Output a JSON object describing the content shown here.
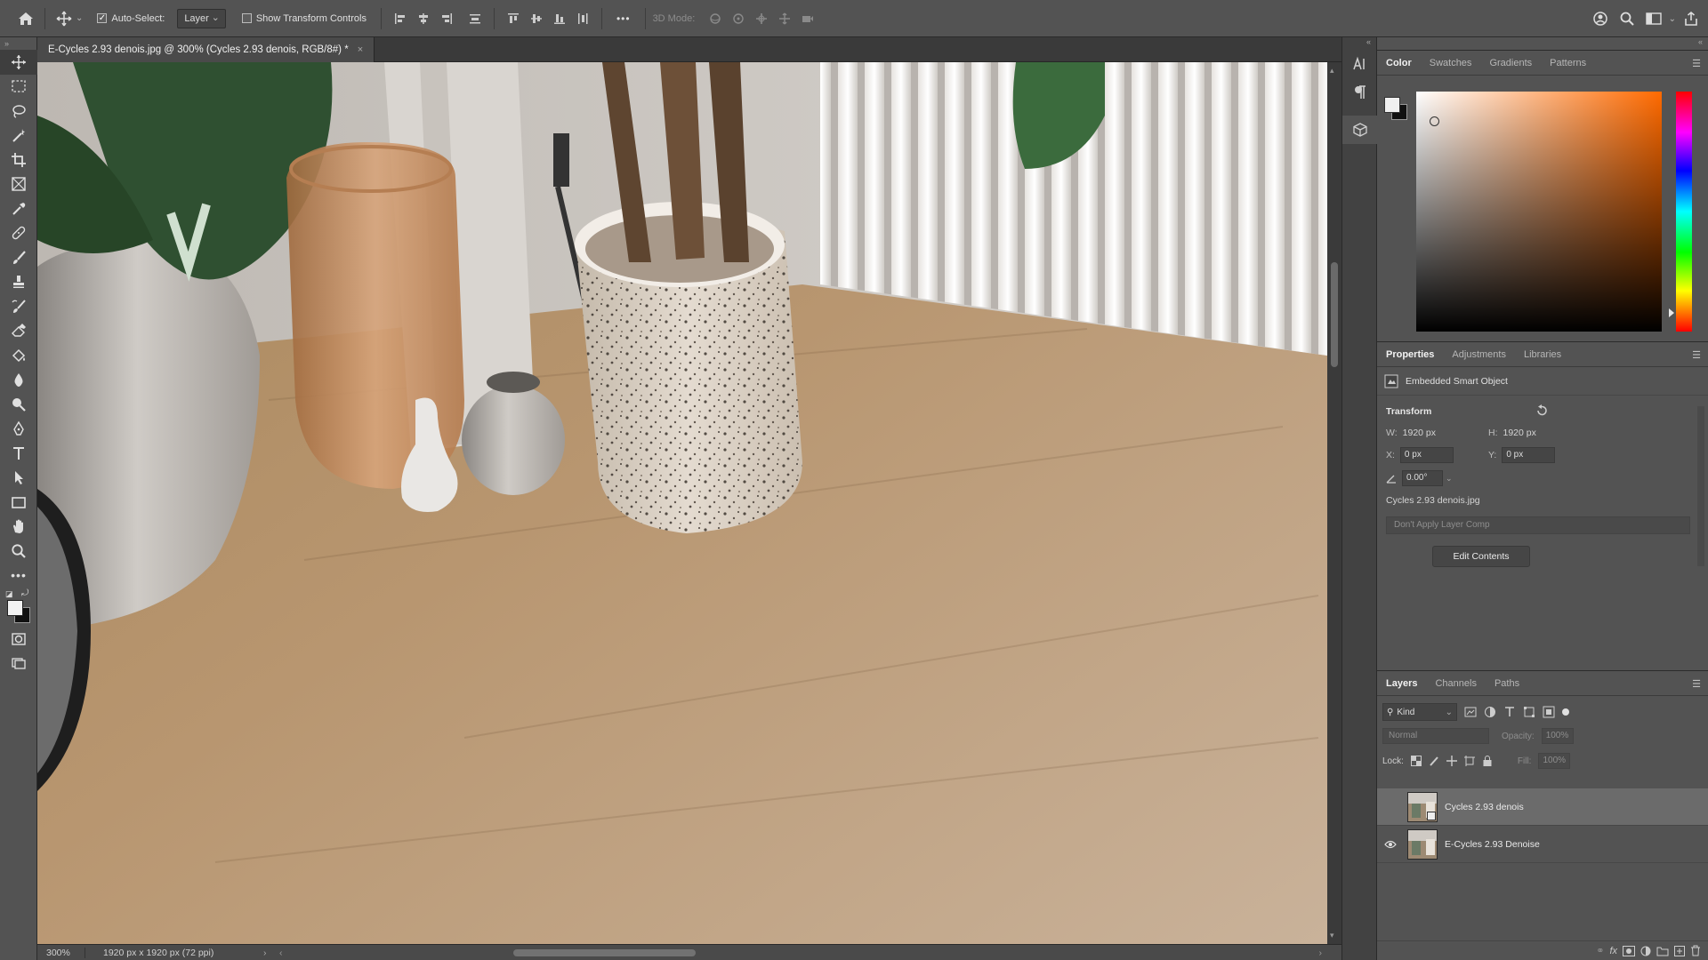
{
  "options_bar": {
    "auto_select_label": "Auto-Select:",
    "auto_select_checked": true,
    "target_select": "Layer",
    "show_transform_label": "Show Transform Controls",
    "show_transform_checked": false,
    "mode_3d_label": "3D Mode:",
    "more_label": "•••"
  },
  "document": {
    "tab_title": "E-Cycles 2.93 denois.jpg @ 300% (Cycles 2.93 denois, RGB/8#) *",
    "close_glyph": "×",
    "zoom": "300%",
    "doc_info": "1920 px x 1920 px (72 ppi)",
    "status_caret": "›",
    "hscroll_left": "‹",
    "hscroll_right": "›"
  },
  "color_panel": {
    "tabs": [
      "Color",
      "Swatches",
      "Gradients",
      "Patterns"
    ],
    "active_tab": "Color",
    "foreground": "#f0f0f0",
    "background": "#111111",
    "hue_accent": "#ff6a00"
  },
  "properties_panel": {
    "tabs": [
      "Properties",
      "Adjustments",
      "Libraries"
    ],
    "active_tab": "Properties",
    "object_type": "Embedded Smart Object",
    "transform_heading": "Transform",
    "w_label": "W:",
    "w_value": "1920 px",
    "h_label": "H:",
    "h_value": "1920 px",
    "x_label": "X:",
    "x_value": "0 px",
    "y_label": "Y:",
    "y_value": "0 px",
    "angle_value": "0.00°",
    "source_file": "Cycles 2.93 denois.jpg",
    "layer_comp": "Don't Apply Layer Comp",
    "edit_button": "Edit Contents"
  },
  "layers_panel": {
    "tabs": [
      "Layers",
      "Channels",
      "Paths"
    ],
    "active_tab": "Layers",
    "filter_kind": "Kind",
    "blend_mode": "Normal",
    "opacity_label": "Opacity:",
    "opacity_value": "100%",
    "lock_label": "Lock:",
    "fill_label": "Fill:",
    "fill_value": "100%",
    "layers": [
      {
        "name": "Cycles 2.93 denois",
        "selected": true,
        "visible": false,
        "smart_object": true
      },
      {
        "name": "E-Cycles 2.93 Denoise",
        "selected": false,
        "visible": true,
        "smart_object": false
      }
    ]
  },
  "toolbar": {
    "tools": [
      "move-tool",
      "rect-marquee-tool",
      "lasso-tool",
      "magic-wand-tool",
      "crop-tool",
      "frame-tool",
      "eyedropper-tool",
      "healing-brush-tool",
      "brush-tool",
      "clone-stamp-tool",
      "history-brush-tool",
      "eraser-tool",
      "paint-bucket-tool",
      "blur-tool",
      "dodge-tool",
      "pen-tool",
      "type-tool",
      "path-selection-tool",
      "rectangle-tool",
      "hand-tool",
      "zoom-tool",
      "edit-toolbar"
    ],
    "active_tool": "move-tool"
  }
}
